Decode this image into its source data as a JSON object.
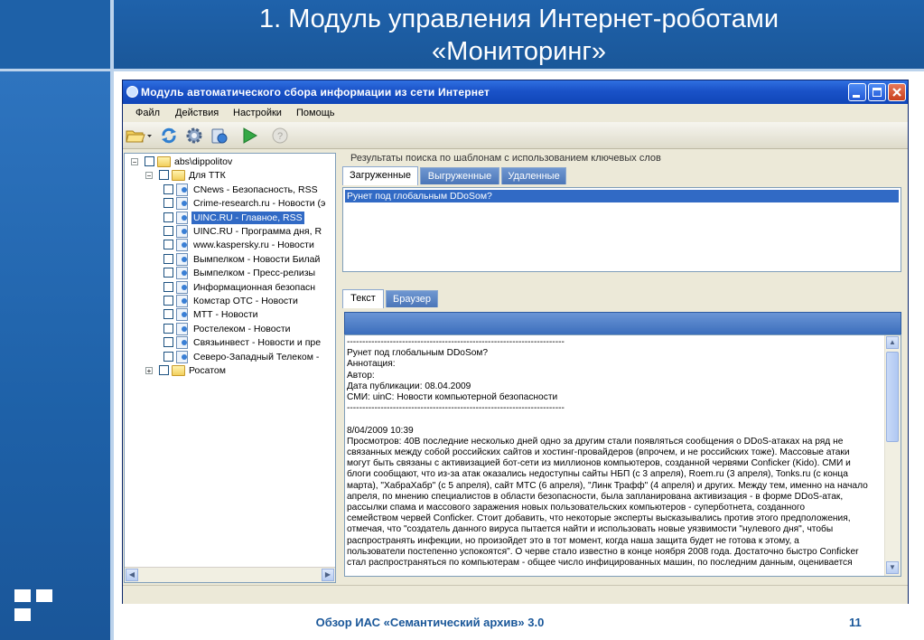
{
  "slide": {
    "title_line1": "1. Модуль управления Интернет-роботами",
    "title_line2": "«Мониторинг»",
    "footer": "Обзор ИАС «Семантический архив» 3.0",
    "page_number": "11",
    "accent_color": "#1e61a8"
  },
  "window": {
    "title": "Модуль автоматического сбора информации из сети Интернет",
    "menu": [
      "Файл",
      "Действия",
      "Настройки",
      "Помощь"
    ],
    "toolbar_icons": [
      "folder-open-icon",
      "refresh-icon",
      "gear-icon",
      "server-icon",
      "play-icon",
      "help-icon"
    ]
  },
  "tree": {
    "nodes": [
      {
        "label": "abs\\dippolitov",
        "type": "folder",
        "level": 0,
        "expander": "−"
      },
      {
        "label": "Для ТТК",
        "type": "folder",
        "level": 1,
        "expander": "−"
      },
      {
        "label": "CNews - Безопасность, RSS",
        "type": "doc",
        "level": 2
      },
      {
        "label": "Crime-research.ru - Новости (э",
        "type": "doc",
        "level": 2
      },
      {
        "label": "UINC.RU - Главное, RSS",
        "type": "doc",
        "level": 2,
        "selected": true
      },
      {
        "label": "UINC.RU - Программа дня, R",
        "type": "doc",
        "level": 2
      },
      {
        "label": "www.kaspersky.ru - Новости",
        "type": "doc",
        "level": 2
      },
      {
        "label": "Вымпелком - Новости Билай",
        "type": "doc",
        "level": 2
      },
      {
        "label": "Вымпелком - Пресс-релизы",
        "type": "doc",
        "level": 2
      },
      {
        "label": "Информационная безопасн",
        "type": "doc",
        "level": 2
      },
      {
        "label": "Комстар ОТС - Новости",
        "type": "doc",
        "level": 2
      },
      {
        "label": "МТТ - Новости",
        "type": "doc",
        "level": 2
      },
      {
        "label": "Ростелеком - Новости",
        "type": "doc",
        "level": 2
      },
      {
        "label": "Связьинвест - Новости и пре",
        "type": "doc",
        "level": 2
      },
      {
        "label": "Северо-Западный Телеком -",
        "type": "doc",
        "level": 2
      },
      {
        "label": "Росатом",
        "type": "folder",
        "level": 1,
        "expander": "+"
      }
    ]
  },
  "results": {
    "header": "Результаты поиска по шаблонам с использованием ключевых слов",
    "tabs": [
      "Загруженные",
      "Выгруженные",
      "Удаленные"
    ],
    "active_tab": 0,
    "rows": [
      "Рунет под глобальным DDoSом?"
    ]
  },
  "detail": {
    "tabs": [
      "Текст",
      "Браузер"
    ],
    "active_tab": 0,
    "lines": [
      "-----------------------------------------------------------------------",
      "Рунет под глобальным DDoSом?",
      "Аннотация:",
      "Автор:",
      "Дата публикации: 08.04.2009",
      "СМИ: uinC: Новости компьютерной безопасности",
      "-----------------------------------------------------------------------",
      "",
      "8/04/2009 10:39",
      "Просмотров: 40В последние несколько дней одно за другим стали появляться сообщения о DDoS-атаках на ряд не",
      "связанных между собой российских сайтов и хостинг-провайдеров (впрочем, и не российских тоже). Массовые атаки",
      "могут быть связаны с активизацией бот-сети из миллионов компьютеров, созданной червями Conficker (Kido). СМИ и",
      "блоги сообщают, что из-за атак оказались недоступны сайты НБП (с 3 апреля), Roem.ru (3 апреля), Tonks.ru (с конца",
      "марта), \"ХабраХабр\" (с 5 апреля), сайт МТС (6 апреля), \"Линк Трафф\" (4 апреля) и других. Между тем, именно на начало",
      "апреля, по мнению специалистов в области безопасности, была запланирована активизация - в форме DDoS-атак,",
      "рассылки спама и массового заражения новых пользовательских компьютеров - суперботнета, созданного",
      "семейством червей Conficker. Стоит добавить, что некоторые эксперты высказывались против этого предположения,",
      "отмечая, что \"создатель данного вируса пытается найти и использовать новые уязвимости \"нулевого дня\", чтобы",
      "распространять инфекции, но произойдет это в тот момент, когда наша защита будет не готова к этому, а",
      "пользователи постепенно успокоятся\". О черве стало известно в конце ноября 2008 года. Достаточно быстро Conficker",
      "стал распространяться по компьютерам - общее число инфицированных машин, по последним данным, оценивается"
    ]
  }
}
